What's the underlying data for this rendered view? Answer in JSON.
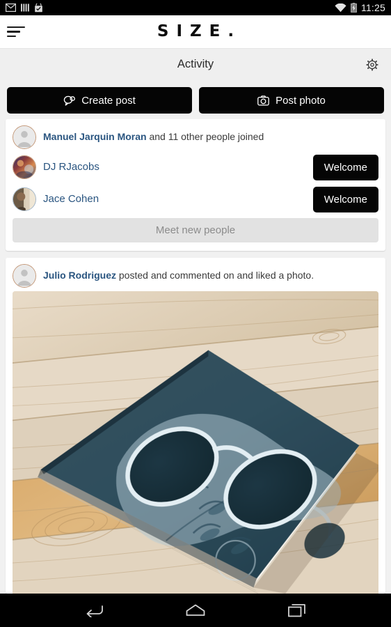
{
  "statusbar": {
    "time": "11:25",
    "icons": [
      "gmail-icon",
      "signal-bars-icon",
      "shopping-bag-check-icon",
      "wifi-icon",
      "battery-charging-icon"
    ]
  },
  "brandbar": {
    "menu_icon": "hamburger-menu-icon",
    "logo": "SIZE."
  },
  "activitybar": {
    "title": "Activity",
    "settings_icon": "gear-icon"
  },
  "actions": {
    "create_post_label": "Create post",
    "create_post_icon": "chat-bubble-icon",
    "post_photo_label": "Post photo",
    "post_photo_icon": "camera-icon"
  },
  "feed": {
    "join_card": {
      "joined_name": "Manuel Jarquin Moran",
      "joined_suffix": " and 11 other people joined",
      "people": [
        {
          "name": "DJ RJacobs",
          "action_label": "Welcome"
        },
        {
          "name": "Jace Cohen",
          "action_label": "Welcome"
        }
      ],
      "meet_label": "Meet new people"
    },
    "photo_card": {
      "author": "Julio Rodriguez",
      "action_text": " posted and commented on and liked a photo.",
      "photo_alt": "dark teal hardcover book with spectacles graphic on light wooden floor"
    }
  },
  "navbar": {
    "back_icon": "back-arrow-icon",
    "home_icon": "home-icon",
    "recents_icon": "recent-apps-icon"
  },
  "colors": {
    "page_background": "#f1f1f1",
    "card_background": "#ffffff",
    "accent_black": "#050505",
    "link_blue": "#2a5580",
    "muted_gray": "#8c8c8c",
    "activity_bar": "#efefef"
  }
}
